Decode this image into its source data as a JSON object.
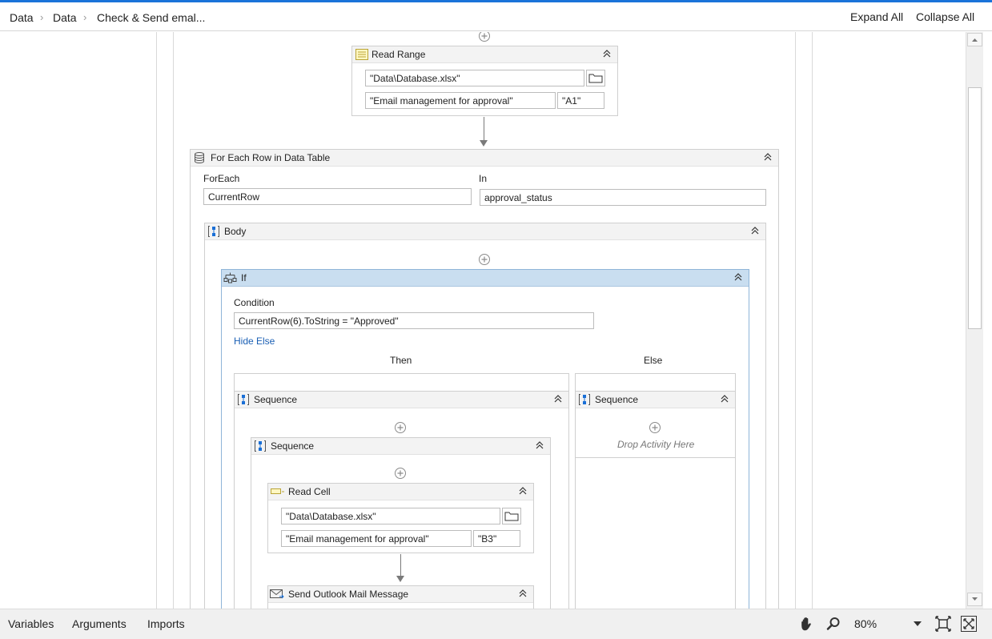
{
  "breadcrumb": {
    "items": [
      "Data",
      "Data",
      "Check & Send emal..."
    ]
  },
  "header": {
    "expand_all": "Expand All",
    "collapse_all": "Collapse All"
  },
  "read_range": {
    "title": "Read Range",
    "file": "\"Data\\Database.xlsx\"",
    "sheet": "\"Email management for approval\"",
    "range": "\"A1\""
  },
  "for_each_row": {
    "title": "For Each Row in Data Table",
    "foreach_label": "ForEach",
    "foreach_value": "CurrentRow",
    "in_label": "In",
    "in_value": "approval_status"
  },
  "body": {
    "title": "Body"
  },
  "if_block": {
    "title": "If",
    "condition_label": "Condition",
    "condition_value": "CurrentRow(6).ToString = \"Approved\"",
    "hide_else": "Hide Else",
    "then_label": "Then",
    "else_label": "Else"
  },
  "then_sequence": {
    "title": "Sequence"
  },
  "inner_sequence": {
    "title": "Sequence"
  },
  "else_sequence": {
    "title": "Sequence",
    "drop_text": "Drop Activity Here"
  },
  "read_cell": {
    "title": "Read Cell",
    "file": "\"Data\\Database.xlsx\"",
    "sheet": "\"Email management for approval\"",
    "cell": "\"B3\""
  },
  "send_mail": {
    "title": "Send Outlook Mail Message"
  },
  "footer": {
    "tabs": [
      "Variables",
      "Arguments",
      "Imports"
    ],
    "zoom": "80%"
  },
  "colors": {
    "accent": "#1a73d9",
    "if_header": "#c9def0",
    "link": "#1a5fb4"
  }
}
